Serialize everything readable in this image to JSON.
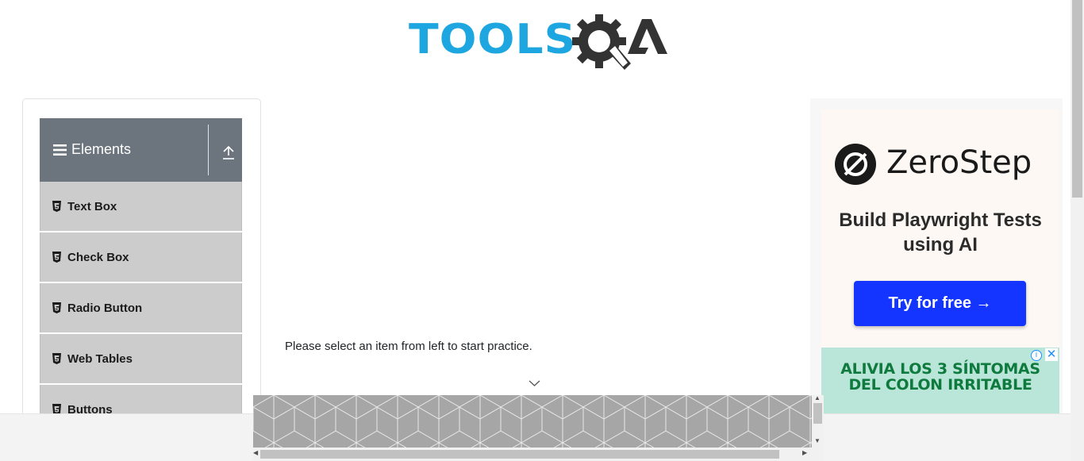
{
  "logo": {
    "text": "TOOLS",
    "alt_text": "TOOLSQA"
  },
  "sidebar": {
    "group_title": "Elements",
    "items": [
      {
        "label": "Text Box"
      },
      {
        "label": "Check Box"
      },
      {
        "label": "Radio Button"
      },
      {
        "label": "Web Tables"
      },
      {
        "label": "Buttons"
      }
    ]
  },
  "main": {
    "message": "Please select an item from left to start practice."
  },
  "ad": {
    "brand": "ZeroStep",
    "headline": "Build Playwright Tests using AI",
    "cta": "Try for free →",
    "banner_line1": "ALIVIA LOS 3  SÍNTOMAS",
    "banner_line2": "DEL COLON IRRITABLE",
    "info_icon": "i",
    "close_icon": "✕"
  },
  "colors": {
    "logo_blue": "#1ea6e0",
    "logo_dark": "#333333",
    "sidebar_header": "#6c757d",
    "menu_item": "#cccccc",
    "cta_blue": "#1434ff",
    "banner_green": "#0f7a3d"
  },
  "icons": {
    "menu": "hamburger-icon",
    "collapse": "upload-arrow-icon",
    "item": "html5-icon",
    "chevron": "chevron-down-icon"
  }
}
